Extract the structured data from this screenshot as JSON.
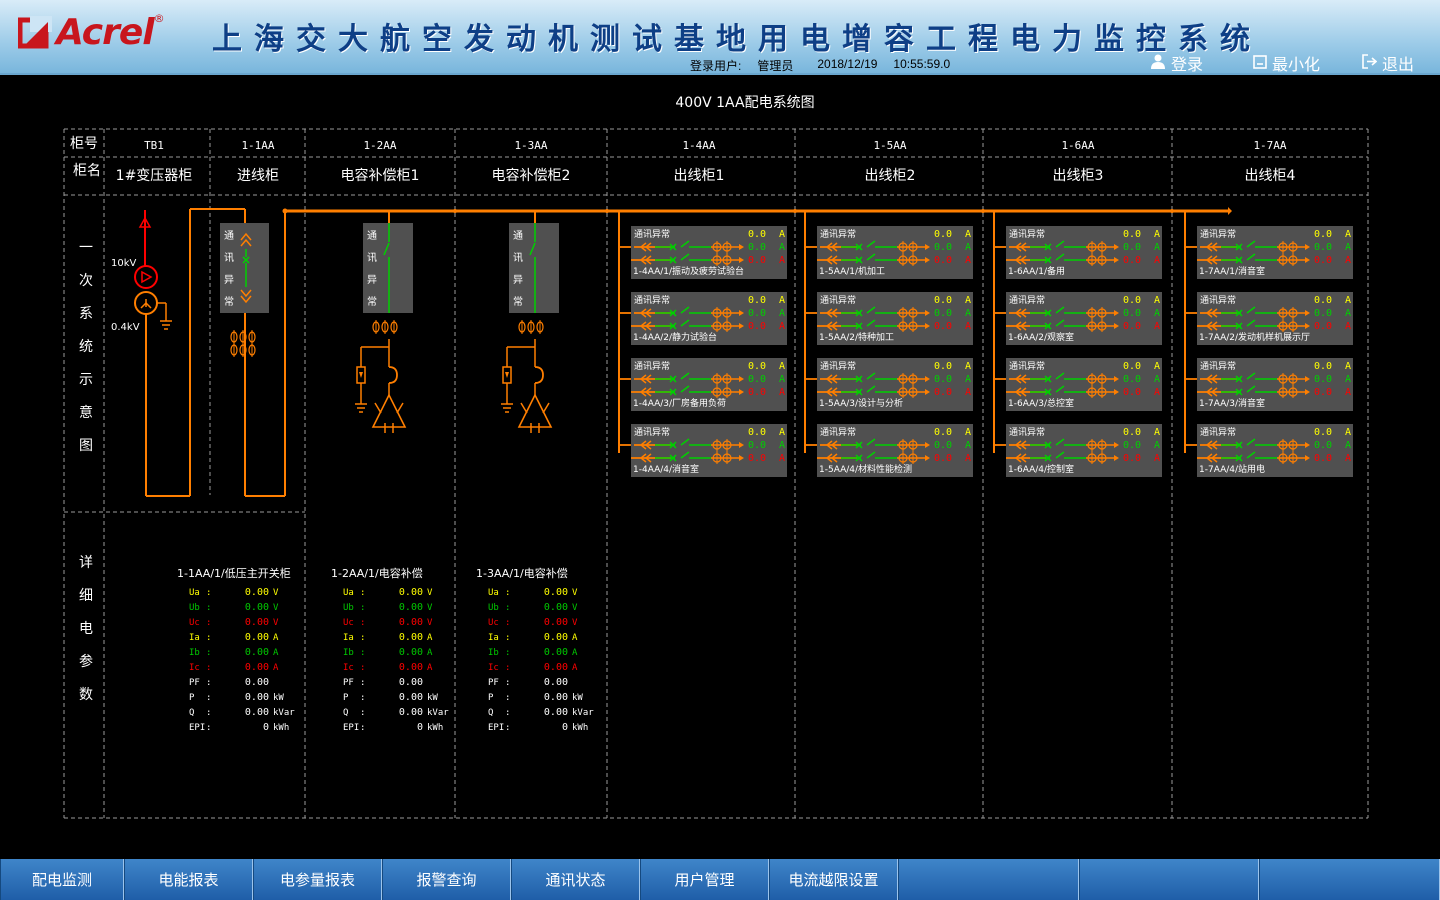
{
  "header": {
    "logo_text": "Acrel",
    "logo_reg": "®",
    "system_title": "上海交大航空发动机测试基地用电增容工程电力监控系统",
    "login_label": "登录用户:",
    "user": "管理员",
    "date": "2018/12/19",
    "time": "10:55:59.0",
    "login_button": "登录",
    "minimize_button": "最小化",
    "exit_button": "退出"
  },
  "diagram": {
    "title": "400V 1AA配电系统图",
    "row_labels": {
      "cabinet_no": "柜号",
      "cabinet_name": "柜名",
      "primary": "一次系统示意图",
      "detail": "详细电参数"
    },
    "transformer": {
      "hv": "10kV",
      "lv": "0.4kV"
    },
    "columns": [
      {
        "no": "TB1",
        "name": "1#变压器柜"
      },
      {
        "no": "1-1AA",
        "name": "进线柜"
      },
      {
        "no": "1-2AA",
        "name": "电容补偿柜1"
      },
      {
        "no": "1-3AA",
        "name": "电容补偿柜2"
      },
      {
        "no": "1-4AA",
        "name": "出线柜1"
      },
      {
        "no": "1-5AA",
        "name": "出线柜2"
      },
      {
        "no": "1-6AA",
        "name": "出线柜3"
      },
      {
        "no": "1-7AA",
        "name": "出线柜4"
      }
    ],
    "switch_status": [
      "通",
      "讯",
      "异",
      "常"
    ],
    "feeder_status": "通讯异常",
    "feeder_value": "0.0",
    "feeder_unit": "A",
    "feeders": [
      [
        "1-4AA/1/振动及疲劳试验台",
        "1-4AA/2/静力试验台",
        "1-4AA/3/厂房备用负荷",
        "1-4AA/4/消音室"
      ],
      [
        "1-5AA/1/机加工",
        "1-5AA/2/特种加工",
        "1-5AA/3/设计与分析",
        "1-5AA/4/材料性能检测"
      ],
      [
        "1-6AA/1/备用",
        "1-6AA/2/观察室",
        "1-6AA/3/总控室",
        "1-6AA/4/控制室"
      ],
      [
        "1-7AA/1/消音室",
        "1-7AA/2/发动机样机展示厅",
        "1-7AA/3/消音室",
        "1-7AA/4/站用电"
      ]
    ],
    "detail_titles": [
      "1-1AA/1/低压主开关柜",
      "1-2AA/1/电容补偿",
      "1-3AA/1/电容补偿"
    ],
    "params": [
      {
        "label": "Ua",
        "sep": ":",
        "value": "0.00",
        "unit": "V",
        "color": "#ffff00"
      },
      {
        "label": "Ub",
        "sep": ":",
        "value": "0.00",
        "unit": "V",
        "color": "#00c800"
      },
      {
        "label": "Uc",
        "sep": ":",
        "value": "0.00",
        "unit": "V",
        "color": "#ff0000"
      },
      {
        "label": "Ia",
        "sep": ":",
        "value": "0.00",
        "unit": "A",
        "color": "#ffff00"
      },
      {
        "label": "Ib",
        "sep": ":",
        "value": "0.00",
        "unit": "A",
        "color": "#00c800"
      },
      {
        "label": "Ic",
        "sep": ":",
        "value": "0.00",
        "unit": "A",
        "color": "#ff0000"
      },
      {
        "label": "PF",
        "sep": ":",
        "value": "0.00",
        "unit": "",
        "color": "#ffffff"
      },
      {
        "label": "P",
        "sep": ":",
        "value": "0.00",
        "unit": "kW",
        "color": "#ffffff"
      },
      {
        "label": "Q",
        "sep": ":",
        "value": "0.00",
        "unit": "kVar",
        "color": "#ffffff"
      },
      {
        "label": "EPI",
        "sep": ":",
        "value": "0",
        "unit": "kWh",
        "color": "#ffffff"
      }
    ],
    "colors": {
      "bus": "#ff7f00",
      "grid": "#9a9a9a",
      "text": "#ffffff",
      "green": "#00d000",
      "red": "#ff0000",
      "yellow": "#ffff00",
      "panel": "#505050"
    }
  },
  "nav": {
    "tabs": [
      "配电监测",
      "电能报表",
      "电参量报表",
      "报警查询",
      "通讯状态",
      "用户管理",
      "电流越限设置"
    ]
  }
}
